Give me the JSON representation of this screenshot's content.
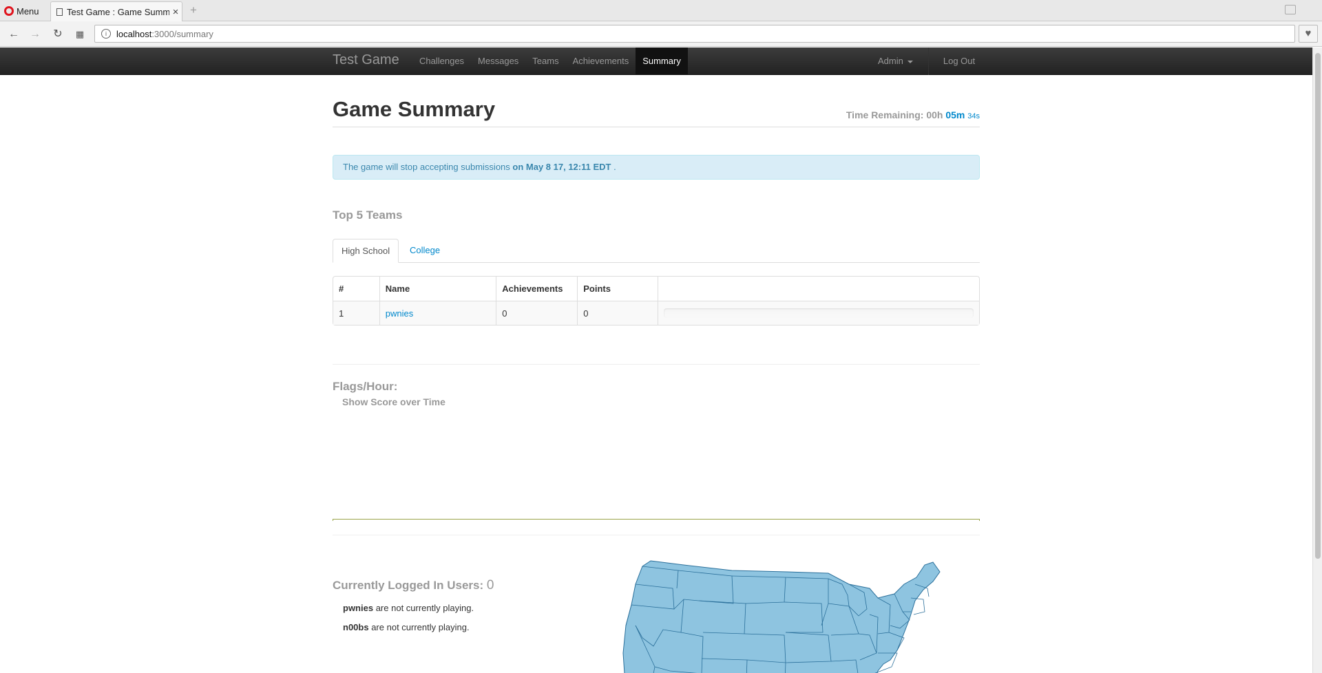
{
  "browser": {
    "menu_label": "Menu",
    "tab_title": "Test Game : Game Summary",
    "tab_close": "×",
    "new_tab": "+",
    "url_host": "localhost",
    "url_path": ":3000/summary"
  },
  "navbar": {
    "brand": "Test Game",
    "links": [
      "Challenges",
      "Messages",
      "Teams",
      "Achievements",
      "Summary"
    ],
    "active": "Summary",
    "admin": "Admin",
    "logout": "Log Out"
  },
  "header": {
    "title": "Game Summary",
    "time_label": "Time Remaining:",
    "time_hours": "00h",
    "time_minutes": "05m",
    "time_seconds": "34s"
  },
  "alert": {
    "prefix": "The game will stop accepting submissions",
    "date": "on May 8 17, 12:11 EDT",
    "suffix": "."
  },
  "top_teams": {
    "title": "Top 5 Teams",
    "tabs": [
      "High School",
      "College"
    ],
    "active_tab": "High School",
    "columns": [
      "#",
      "Name",
      "Achievements",
      "Points",
      ""
    ],
    "rows": [
      {
        "rank": "1",
        "name": "pwnies",
        "achievements": "0",
        "points": "0",
        "progress": 0
      }
    ]
  },
  "flags": {
    "title": "Flags/Hour:",
    "toggle": "Show Score over Time"
  },
  "users": {
    "title": "Currently Logged In Users:",
    "count": "0",
    "lines": [
      {
        "team": "pwnies",
        "status": "are not currently playing."
      },
      {
        "team": "n00bs",
        "status": "are not currently playing."
      }
    ]
  },
  "colors": {
    "accent": "#0088cc",
    "navbar": "#222222",
    "alert_bg": "#d9edf7",
    "map_fill": "#8ec4e0",
    "map_stroke": "#2a6f9a"
  }
}
